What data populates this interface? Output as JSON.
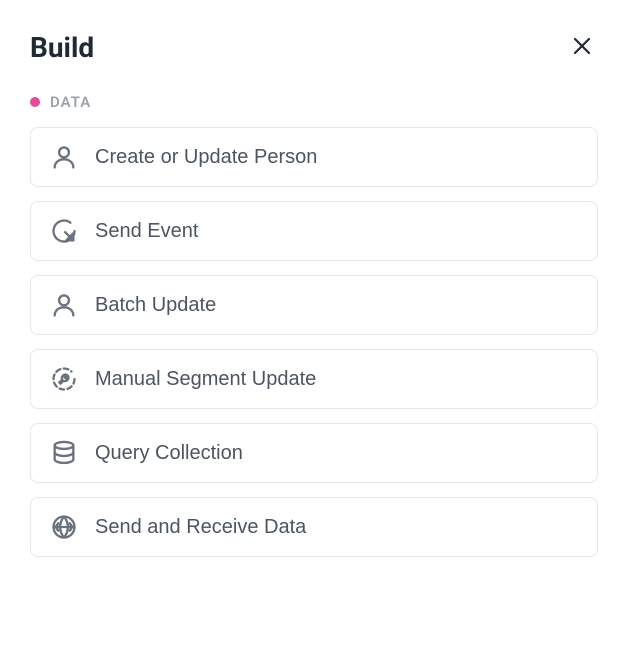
{
  "header": {
    "title": "Build"
  },
  "section": {
    "label": "DATA",
    "dot_color": "#ec4899"
  },
  "actions": [
    {
      "label": "Create or Update Person",
      "icon": "person"
    },
    {
      "label": "Send Event",
      "icon": "event"
    },
    {
      "label": "Batch Update",
      "icon": "person"
    },
    {
      "label": "Manual Segment Update",
      "icon": "wrench-circle"
    },
    {
      "label": "Query Collection",
      "icon": "database"
    },
    {
      "label": "Send and Receive Data",
      "icon": "globe-arrows"
    }
  ]
}
